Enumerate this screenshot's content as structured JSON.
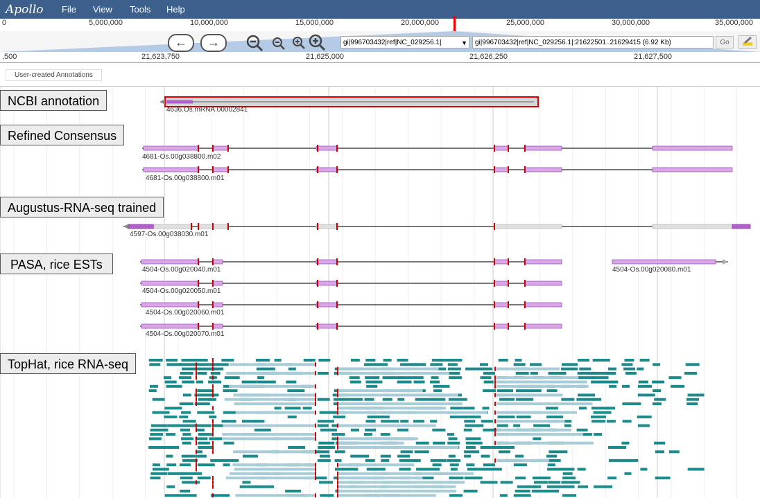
{
  "app": {
    "logo": "Apollo"
  },
  "menu": [
    {
      "label": "File"
    },
    {
      "label": "View"
    },
    {
      "label": "Tools"
    },
    {
      "label": "Help"
    }
  ],
  "overview": {
    "ticks": [
      "0",
      "5,000,000",
      "10,000,000",
      "15,000,000",
      "20,000,000",
      "25,000,000",
      "30,000,000",
      "35,000,000"
    ]
  },
  "nav": {
    "back_icon": "arrow-left-icon",
    "forward_icon": "arrow-right-icon",
    "ref_select_value": "gi|996703432|ref|NC_029256.1|",
    "location_value": "gi|996703432|ref|NC_029256.1|:21622501..21629415 (6.92 Kb)",
    "go_label": "Go"
  },
  "ruler": {
    "labels": [
      ",500",
      "21,623,750",
      "21,625,000",
      "21,626,250",
      "21,627,500"
    ]
  },
  "user_annotations": {
    "label": "User-created Annotations"
  },
  "tracks": {
    "ncbi": {
      "label": "NCBI annotation",
      "features": [
        "4636.Os.mRNA.00002841"
      ]
    },
    "refined": {
      "label": "Refined Consensus",
      "features": [
        "4681-Os.00g038800.m02",
        "4681-Os.00g038800.m01"
      ]
    },
    "augustus": {
      "label": "Augustus-RNA-seq trained",
      "features": [
        "4597-Os.00g038030.m01"
      ]
    },
    "pasa": {
      "label": "PASA, rice ESTs",
      "features": [
        "4504-Os.00g020040.m01",
        "4504-Os.00g020050.m01",
        "4504-Os.00g020060.m01",
        "4504-Os.00g020070.m01",
        "4504-Os.00g020080.m01"
      ]
    },
    "tophat": {
      "label": "TopHat, rice RNA-seq"
    }
  },
  "colors": {
    "menubar": "#3d5f8c",
    "exon": "#d9a6e6",
    "exon_border": "#a050c0",
    "utr": "#e0e0e0",
    "splice": "#cc0000",
    "read_teal": "#1b8a8a",
    "read_light": "#a8cdd8",
    "selected_box": "#e00000"
  }
}
